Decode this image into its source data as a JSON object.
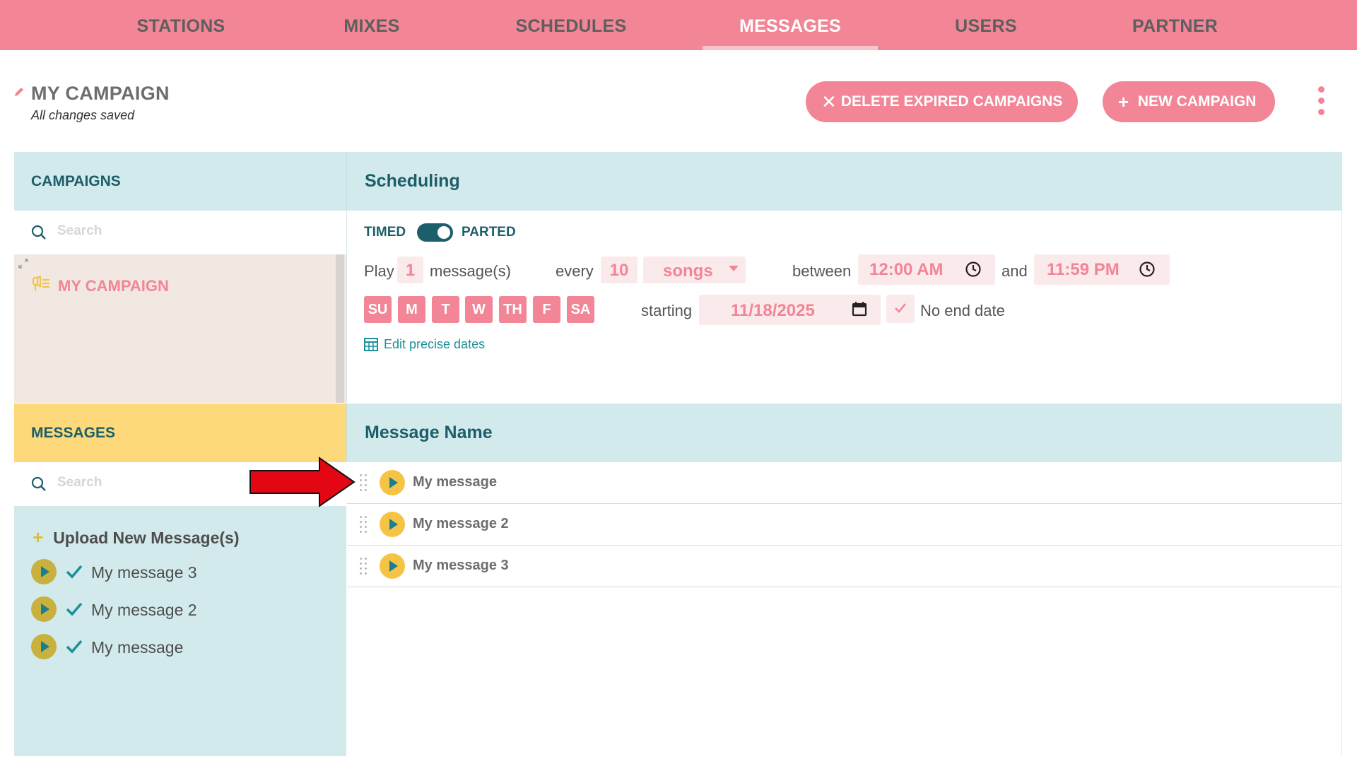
{
  "nav": {
    "items": [
      "STATIONS",
      "MIXES",
      "SCHEDULES",
      "MESSAGES",
      "USERS",
      "PARTNER"
    ],
    "active": "MESSAGES"
  },
  "header": {
    "title": "MY CAMPAIGN",
    "status": "All changes saved",
    "delete_button": "DELETE EXPIRED CAMPAIGNS",
    "new_button": "NEW CAMPAIGN"
  },
  "campaigns": {
    "heading": "CAMPAIGNS",
    "search_placeholder": "Search",
    "items": [
      "MY CAMPAIGN"
    ]
  },
  "scheduling": {
    "heading": "Scheduling",
    "toggle_left": "TIMED",
    "toggle_right": "PARTED",
    "play_label": "Play",
    "play_count": "1",
    "messages_label": "message(s)",
    "every_label": "every",
    "every_count": "10",
    "unit": "songs",
    "between_label": "between",
    "start_time": "12:00 AM",
    "and_label": "and",
    "end_time": "11:59 PM",
    "days": [
      "SU",
      "M",
      "T",
      "W",
      "TH",
      "F",
      "SA"
    ],
    "starting_label": "starting",
    "start_date": "11/18/2025",
    "no_end_date_label": "No end date",
    "edit_dates_label": "Edit precise dates"
  },
  "messages": {
    "heading": "MESSAGES",
    "search_placeholder": "Search",
    "upload_label": "Upload New Message(s)",
    "library": [
      "My message 3",
      "My message 2",
      "My message"
    ]
  },
  "message_table": {
    "heading": "Message Name",
    "rows": [
      "My message",
      "My message 2",
      "My message 3"
    ]
  },
  "colors": {
    "brand_pink": "#f28596",
    "teal_dark": "#1c5e69",
    "panel_teal": "#d2eaec",
    "messages_yellow": "#fdd97b",
    "play_yellow": "#f6c445",
    "annotation_red": "#e30613"
  }
}
